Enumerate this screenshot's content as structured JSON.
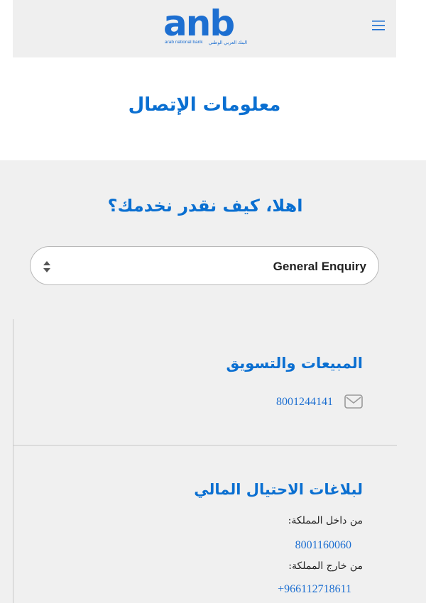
{
  "header": {
    "logo_text": "anb",
    "logo_sub_en": "arab national bank",
    "logo_sub_ar": "البنك العربي الوطني",
    "menu_icon": "hamburger-menu-icon",
    "brand_color": "#1d6fd1"
  },
  "page": {
    "title": "معلومات الإتصال"
  },
  "greeting": "اهلا، كيف نقدر نخدمك؟",
  "enquiry_select": {
    "selected": "General Enquiry"
  },
  "contacts": [
    {
      "title": "المبيعات والتسويق",
      "icon": "mail-icon",
      "phone": "8001244141"
    },
    {
      "title": "لبلاغات الاحتيال المالي",
      "inside_label": "من داخل المملكة:",
      "inside_phone": "8001160060",
      "outside_label": "من خارج المملكة:",
      "outside_phone": "+966112718611"
    }
  ],
  "colors": {
    "accent": "#0a6fd1",
    "header_bg": "#efefef",
    "section_bg": "#f0f0f0"
  }
}
